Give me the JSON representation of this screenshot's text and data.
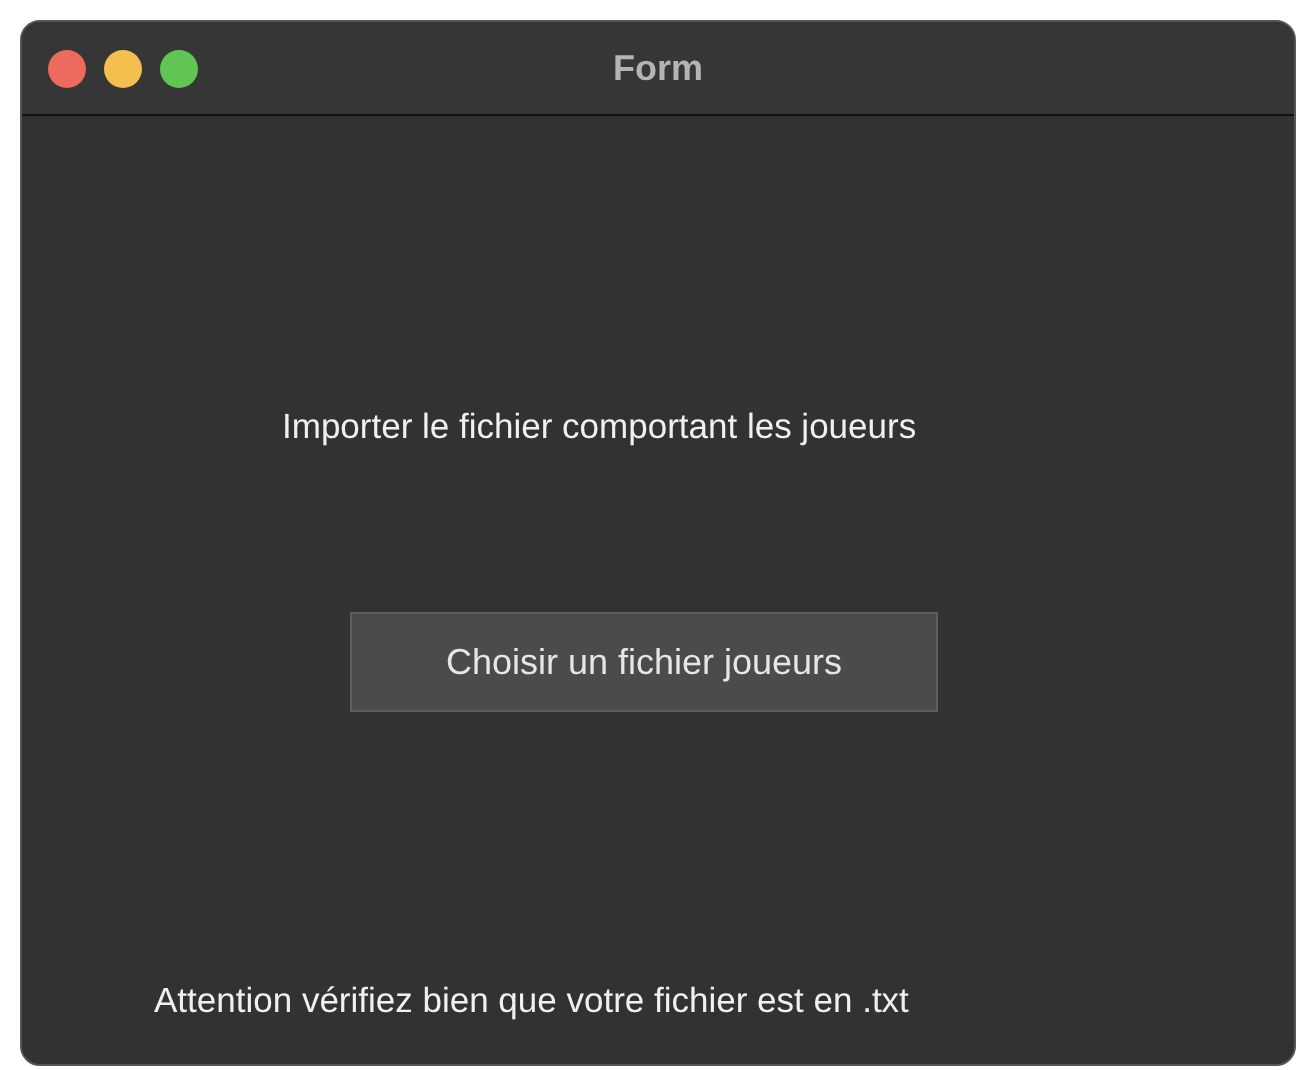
{
  "window": {
    "title": "Form"
  },
  "prompt": "Importer le fichier comportant les joueurs",
  "button": {
    "label": "Choisir un fichier joueurs"
  },
  "warning": "Attention vérifiez bien que votre fichier est en .txt"
}
